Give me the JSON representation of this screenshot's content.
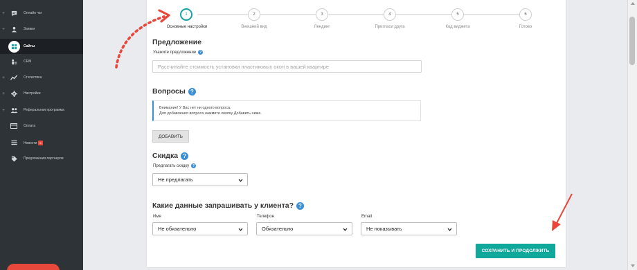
{
  "sidebar": {
    "items": [
      {
        "label": "Онлайн чат",
        "icon": "chat-icon",
        "expandable": true
      },
      {
        "label": "Заявки",
        "icon": "user-icon",
        "expandable": true
      },
      {
        "label": "Сайты",
        "icon": "sites-icon",
        "expandable": false,
        "active": true
      },
      {
        "label": "CRM",
        "icon": "crm-icon",
        "expandable": false
      },
      {
        "label": "Статистика",
        "icon": "stats-icon",
        "expandable": true
      },
      {
        "label": "Настройки",
        "icon": "gear-icon",
        "expandable": true
      },
      {
        "label": "Реферальная программа",
        "icon": "users-icon",
        "expandable": true
      },
      {
        "label": "Оплата",
        "icon": "card-icon",
        "expandable": false
      },
      {
        "label": "Новости",
        "icon": "news-icon",
        "expandable": false,
        "badge": "5"
      },
      {
        "label": "Предложения партнеров",
        "icon": "tag-icon",
        "expandable": false
      }
    ]
  },
  "stepper": {
    "steps": [
      {
        "number": "1",
        "label": "Основные настройки",
        "active": true
      },
      {
        "number": "2",
        "label": "Внешний вид"
      },
      {
        "number": "3",
        "label": "Лендинг"
      },
      {
        "number": "4",
        "label": "Пригласи друга"
      },
      {
        "number": "5",
        "label": "Код виджета"
      },
      {
        "number": "6",
        "label": "Готово"
      }
    ]
  },
  "offer": {
    "heading": "Предложение",
    "label": "Укажите предложение",
    "placeholder": "Рассчитайте стоимость установки пластиковых окон в вашей квартире"
  },
  "questions": {
    "heading": "Вопросы",
    "notice_line1": "Внимание! У Вас нет ни одного вопроса.",
    "notice_line2": "Для добавления вопроса нажмите кнопку Добавить ниже.",
    "add_button": "ДОБАВИТЬ"
  },
  "discount": {
    "heading": "Скидка",
    "label": "Предлагать скидку",
    "selected": "Не предлагать"
  },
  "client_data": {
    "heading": "Какие данные запрашивать у клиента?",
    "fields": [
      {
        "label": "Имя",
        "selected": "Не обязательно"
      },
      {
        "label": "Телефон",
        "selected": "Обязательно"
      },
      {
        "label": "Email",
        "selected": "Не показывать"
      }
    ]
  },
  "save_button": "СОХРАНИТЬ И ПРОДОЛЖИТЬ",
  "colors": {
    "accent": "#17a2a6",
    "primary_button": "#10a89a",
    "sidebar": "#2e3338",
    "annotation": "#e8473b"
  }
}
